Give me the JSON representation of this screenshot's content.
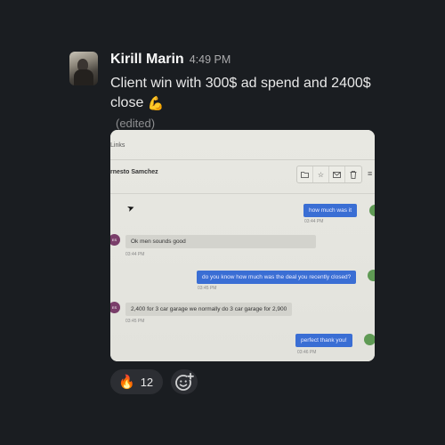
{
  "message": {
    "author": "Kirill Marin",
    "time": "4:49 PM",
    "text": "Client win with 300$ ad spend  and 2400$ close",
    "emoji": "💪",
    "edited": "(edited)"
  },
  "attachment": {
    "links_label": "Links",
    "contact_name": "rnesto Samchez",
    "tool_icons": [
      "folder-icon",
      "star-icon",
      "mail-icon",
      "trash-icon"
    ],
    "messages": [
      {
        "dir": "out",
        "text": "how much was it",
        "time": "03:44 PM"
      },
      {
        "dir": "in",
        "avatar": "ES",
        "text": "Ok men sounds good",
        "time": "03:44 PM"
      },
      {
        "dir": "out",
        "text": "do you know how much was the deal you recently closed?",
        "time": "03:45 PM"
      },
      {
        "dir": "in",
        "avatar": "ES",
        "text": "2,400 for 3 car garage we normally do 3 car garage for 2,900",
        "time": "03:45 PM"
      },
      {
        "dir": "out",
        "text": "perfect thank you!",
        "time": "03:46 PM"
      }
    ]
  },
  "reactions": [
    {
      "emoji": "🔥",
      "name": "fire",
      "count": "12"
    }
  ],
  "add_reaction_icon": "add-emoji-icon"
}
